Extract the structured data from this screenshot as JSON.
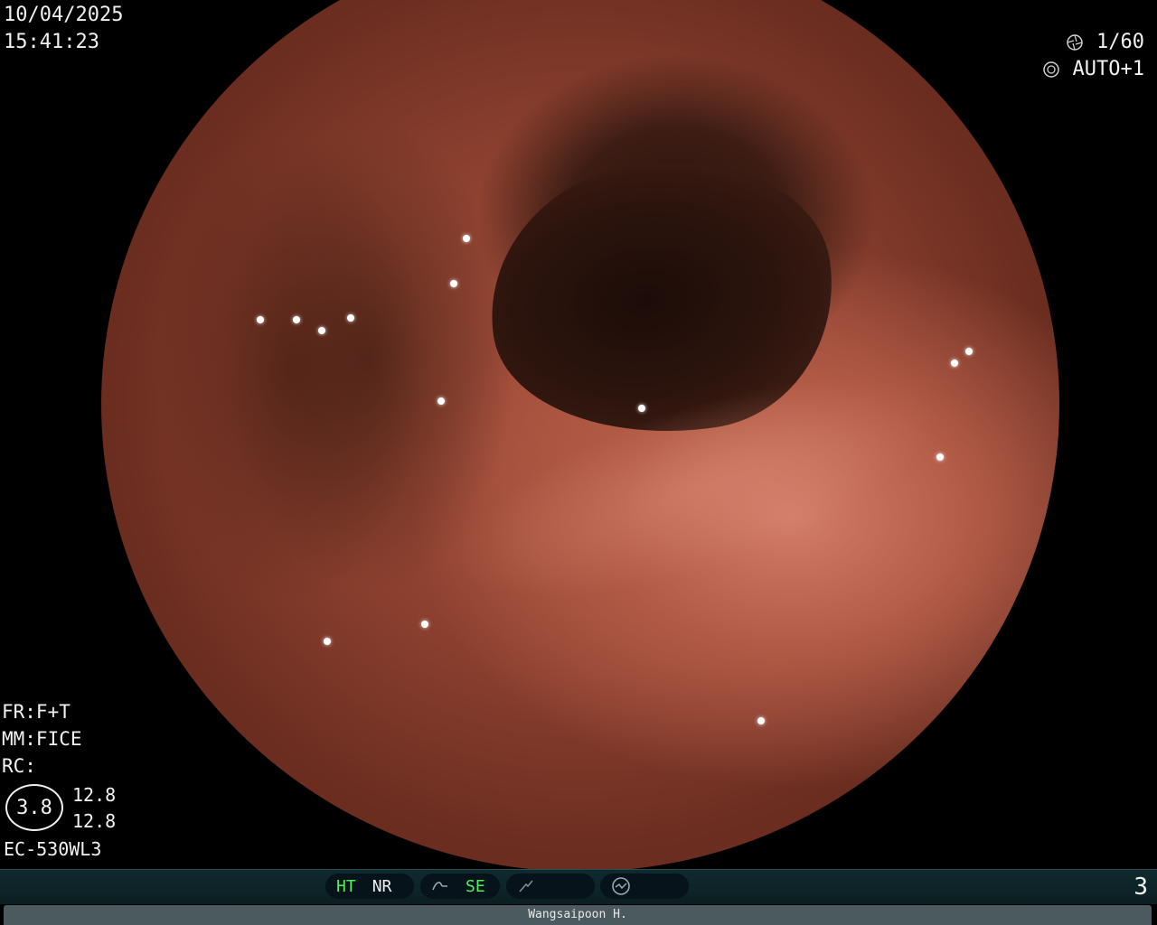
{
  "overlay": {
    "date": "10/04/2025",
    "time": "15:41:23",
    "shutter": "1/60",
    "iris": "AUTO+1",
    "shutter_icon": "aperture-icon",
    "iris_icon": "iris-icon"
  },
  "info": {
    "fr": "FR:F+T",
    "mm": "MM:FICE",
    "rc": "RC:",
    "ratio_center": "3.8",
    "ratio_top": "12.8",
    "ratio_bottom": "12.8",
    "scope_model": "EC-530WL3"
  },
  "status_bar": {
    "ht": "HT",
    "nr": "NR",
    "se": "SE",
    "page": "3",
    "icons": [
      "tone-curve-icon",
      "enhance-icon",
      "gauge-icon"
    ]
  },
  "footer": {
    "operator": "Wangsaipoon H."
  },
  "colors": {
    "status_green": "#4ef05a",
    "status_bar_bg": "#0b1f22",
    "name_bar_bg": "#4a5a5e"
  }
}
